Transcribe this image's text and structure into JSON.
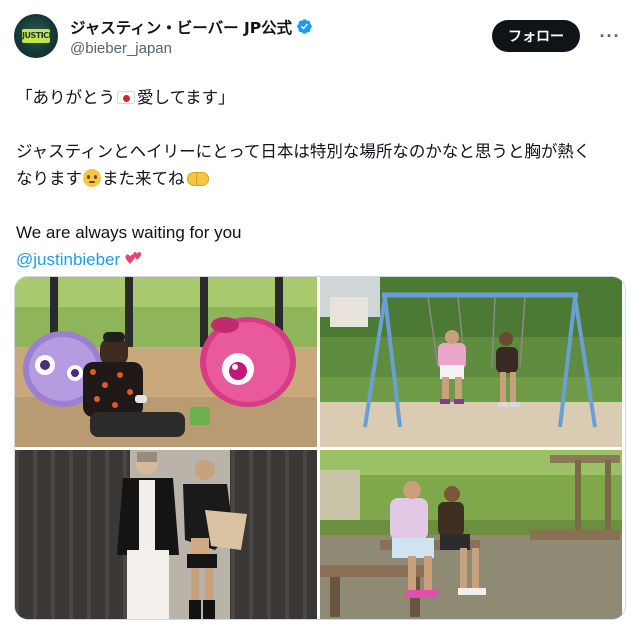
{
  "account": {
    "display_name": "ジャスティン・ビーバー JP公式",
    "handle": "@bieber_japan",
    "avatar_text": "JUSTICE",
    "verified_color": "#1d9bf0"
  },
  "actions": {
    "follow_label": "フォロー",
    "more_label": "···"
  },
  "tweet": {
    "line1_open": "「ありがとう",
    "line1_close": "愛してます」",
    "line2": "ジャスティンとヘイリーにとって日本は特別な場所なのかなと思うと胸が熱く",
    "line3_start": "なります",
    "line3_mid": "また来てね",
    "line4": "We are always waiting for you",
    "mention": "@justinbieber",
    "mention_color": "#1d9bf0"
  },
  "media": {
    "photos": [
      {
        "name": "photo-sofa-plushies"
      },
      {
        "name": "photo-swings"
      },
      {
        "name": "photo-leather-jackets"
      },
      {
        "name": "photo-garden-bench"
      }
    ]
  }
}
